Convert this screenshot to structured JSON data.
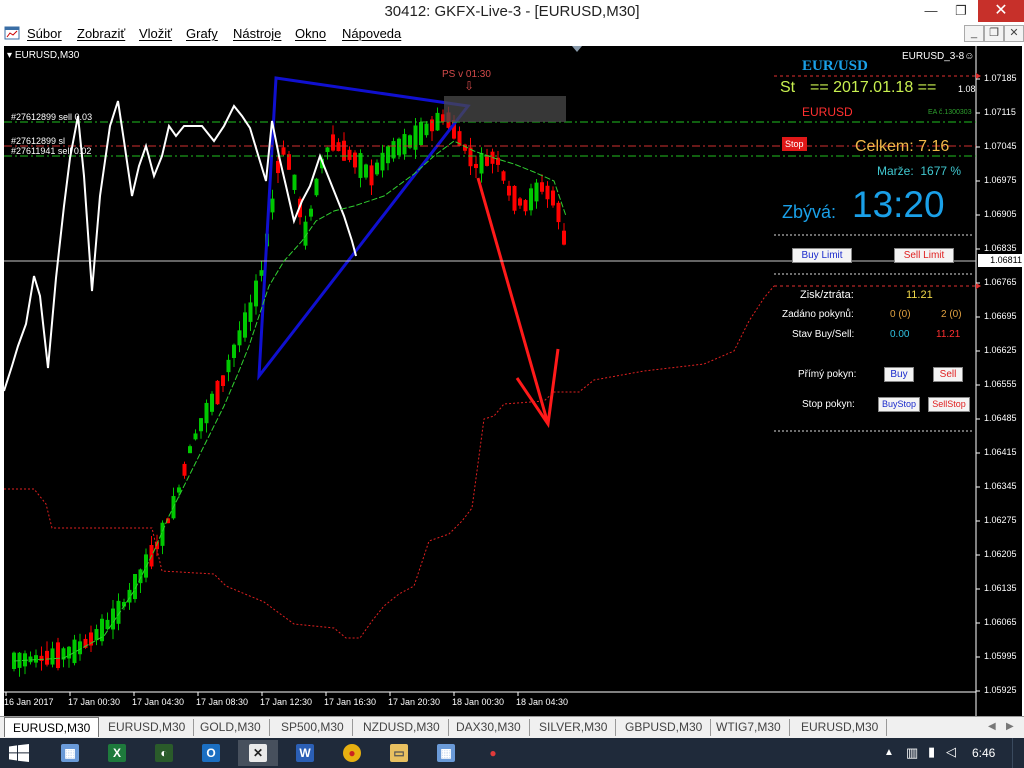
{
  "window": {
    "title": "30412: GKFX-Live-3 - [EURUSD,M30]",
    "min": "—",
    "max": "❐",
    "close": "✕"
  },
  "menu": [
    "Súbor",
    "Zobraziť",
    "Vložiť",
    "Grafy",
    "Nástroje",
    "Okno",
    "Nápoveda"
  ],
  "mdi": {
    "min": "_",
    "restore": "❐",
    "close": "✕"
  },
  "chart": {
    "symbol_label": "EURUSD,M30",
    "ea_label": "EURUSD_3-8",
    "smiley": "☺",
    "ps_label": "PS v 01:30",
    "order_labels": [
      "#27612899 sell 0.03",
      "#27612899 sl",
      "#27611941 sell 0.02"
    ],
    "time_labels": [
      "16 Jan 2017",
      "17 Jan 00:30",
      "17 Jan 04:30",
      "17 Jan 08:30",
      "17 Jan 12:30",
      "17 Jan 16:30",
      "17 Jan 20:30",
      "18 Jan 00:30",
      "18 Jan 04:30"
    ],
    "price_labels": [
      "1.07185",
      "1.07115",
      "1.07045",
      "1.06975",
      "1.06905",
      "1.06835",
      "1.06765",
      "1.06695",
      "1.06625",
      "1.06555",
      "1.06485",
      "1.06415",
      "1.06345",
      "1.06275",
      "1.06205",
      "1.06135",
      "1.06065",
      "1.05995",
      "1.05925"
    ],
    "current_price": "1.06811"
  },
  "panel": {
    "pair": "EUR/USD",
    "day": "St",
    "date_line": "==  2017.01.18  ==",
    "small_value": "1.08",
    "symbol": "EURUSD",
    "ea_note": "EA č.1300303",
    "stop_btn": "Stop",
    "celkem_label": "Celkem:",
    "celkem_value": "7.16",
    "marze_label": "Marže:",
    "marze_value": "1677 %",
    "zbyva_label": "Zbývá:",
    "zbyva_value": "13:20",
    "buy_limit": "Buy Limit",
    "sell_limit": "Sell Limit",
    "zisk_label": "Zisk/ztráta:",
    "zisk_value": "11.21",
    "zadano_label": "Zadáno pokynů:",
    "zadano_buy": "0 (0)",
    "zadano_sell": "2 (0)",
    "stav_label": "Stav Buy/Sell:",
    "stav_buy": "0.00",
    "stav_sell": "11.21",
    "primy_label": "Přímý pokyn:",
    "buy": "Buy",
    "sell": "Sell",
    "stop_label": "Stop pokyn:",
    "buystop": "BuyStop",
    "sellstop": "SellStop"
  },
  "tabs": [
    "EURUSD,M30",
    "EURUSD,M30",
    "GOLD,M30",
    "SP500,M30",
    "NZDUSD,M30",
    "DAX30,M30",
    "SILVER,M30",
    "GBPUSD,M30",
    "WTIG7,M30",
    "EURUSD,M30"
  ],
  "taskbar": {
    "clock": "6:46"
  },
  "colors": {
    "bull": "#00c800",
    "bear": "#ff0000",
    "triangle": "#1010d0",
    "arrow": "#ff1a1a",
    "panel_cyan": "#1aa0e8"
  }
}
